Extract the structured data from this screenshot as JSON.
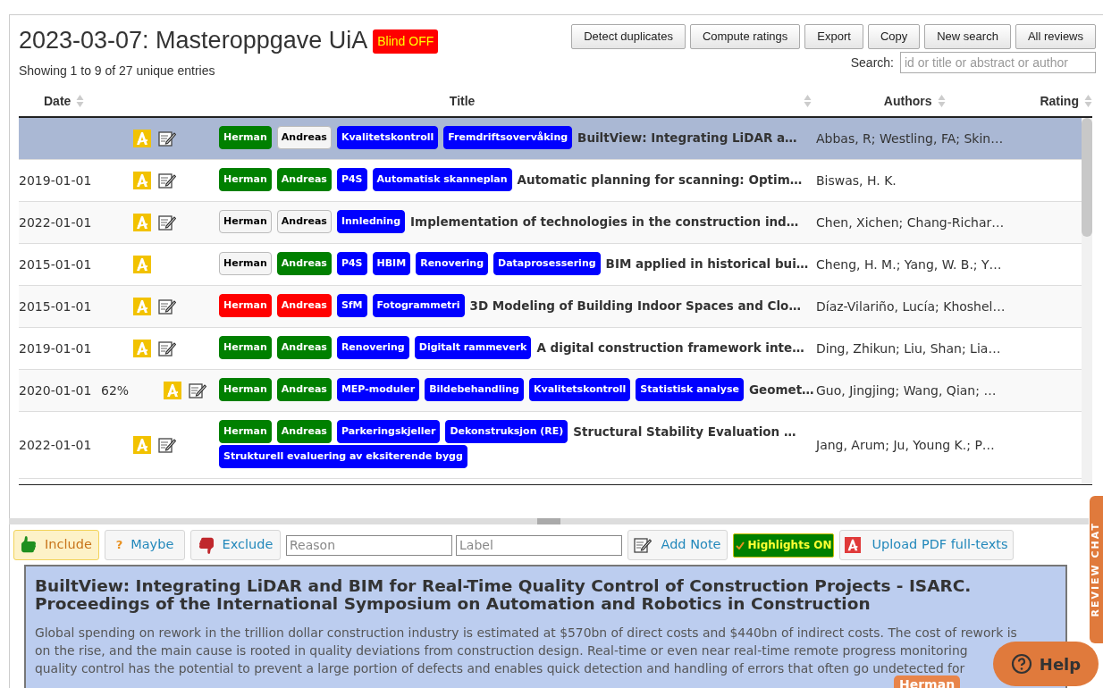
{
  "header": {
    "title": "2023-03-07: Masteroppgave UiA",
    "blind": {
      "label": "Blind OFF",
      "on": false
    },
    "summary": "Showing 1 to 9 of 27 unique entries"
  },
  "toolbar": [
    "Detect duplicates",
    "Compute ratings",
    "Export",
    "Copy",
    "New search",
    "All reviews"
  ],
  "search": {
    "label": "Search:",
    "placeholder": "id or title or abstract or author"
  },
  "table": {
    "columns": [
      "Date",
      "Title",
      "Authors",
      "Rating"
    ],
    "rows": [
      {
        "selected": true,
        "date": "",
        "score": "",
        "has_note": true,
        "tags": [
          {
            "label": "Herman",
            "color": "#008000"
          },
          {
            "label": "Andreas",
            "color": "#f5f5f5"
          },
          {
            "label": "Kvalitetskontroll",
            "color": "#0000ff"
          },
          {
            "label": "Fremdriftsovervåking",
            "color": "#0000ff"
          }
        ],
        "title": "BuiltView: Integrating LiDAR a…",
        "authors": "Abbas, R; Westling, FA; Skin…"
      },
      {
        "selected": false,
        "date": "2019-01-01",
        "score": "",
        "has_note": true,
        "tags": [
          {
            "label": "Herman",
            "color": "#008000"
          },
          {
            "label": "Andreas",
            "color": "#008000"
          },
          {
            "label": "P4S",
            "color": "#0000ff"
          },
          {
            "label": "Automatisk skanneplan",
            "color": "#0000ff"
          }
        ],
        "title": "Automatic planning for scanning: Optim…",
        "authors": "Biswas, H. K."
      },
      {
        "selected": false,
        "date": "2022-01-01",
        "score": "",
        "has_note": true,
        "tags": [
          {
            "label": "Herman",
            "color": "#f5f5f5"
          },
          {
            "label": "Andreas",
            "color": "#f5f5f5"
          },
          {
            "label": "Innledning",
            "color": "#0000ff"
          }
        ],
        "title": "Implementation of technologies in the construction ind…",
        "authors": "Chen, Xichen; Chang-Richar…"
      },
      {
        "selected": false,
        "date": "2015-01-01",
        "score": "",
        "has_note": false,
        "tags": [
          {
            "label": "Herman",
            "color": "#f5f5f5"
          },
          {
            "label": "Andreas",
            "color": "#008000"
          },
          {
            "label": "P4S",
            "color": "#0000ff"
          },
          {
            "label": "HBIM",
            "color": "#0000ff"
          },
          {
            "label": "Renovering",
            "color": "#0000ff"
          },
          {
            "label": "Dataprosessering",
            "color": "#0000ff"
          }
        ],
        "title": "BIM applied in historical bui…",
        "authors": "Cheng, H. M.; Yang, W. B.; Y…"
      },
      {
        "selected": false,
        "date": "2015-01-01",
        "score": "",
        "has_note": true,
        "tags": [
          {
            "label": "Herman",
            "color": "#ff0000"
          },
          {
            "label": "Andreas",
            "color": "#ff0000"
          },
          {
            "label": "SfM",
            "color": "#0000ff"
          },
          {
            "label": "Fotogrammetri",
            "color": "#0000ff"
          }
        ],
        "title": "3D Modeling of Building Indoor Spaces and Clo…",
        "authors": "Díaz-Vilariño, Lucía; Khoshel…"
      },
      {
        "selected": false,
        "date": "2019-01-01",
        "score": "",
        "has_note": true,
        "tags": [
          {
            "label": "Herman",
            "color": "#008000"
          },
          {
            "label": "Andreas",
            "color": "#008000"
          },
          {
            "label": "Renovering",
            "color": "#0000ff"
          },
          {
            "label": "Digitalt rammeverk",
            "color": "#0000ff"
          }
        ],
        "title": "A digital construction framework inte…",
        "authors": "Ding, Zhikun; Liu, Shan; Lia…"
      },
      {
        "selected": false,
        "date": "2020-01-01",
        "score": "62%",
        "has_note": true,
        "tags": [
          {
            "label": "Herman",
            "color": "#008000"
          },
          {
            "label": "Andreas",
            "color": "#008000"
          },
          {
            "label": "MEP-moduler",
            "color": "#0000ff"
          },
          {
            "label": "Bildebehandling",
            "color": "#0000ff"
          },
          {
            "label": "Kvalitetskontroll",
            "color": "#0000ff"
          },
          {
            "label": "Statistisk analyse",
            "color": "#0000ff"
          }
        ],
        "title": "Geomet…",
        "authors": "Guo, Jingjing; Wang, Qian; …"
      },
      {
        "selected": false,
        "date": "2022-01-01",
        "score": "",
        "has_note": true,
        "tags": [
          {
            "label": "Herman",
            "color": "#008000"
          },
          {
            "label": "Andreas",
            "color": "#008000"
          },
          {
            "label": "Parkeringskjeller",
            "color": "#0000ff"
          },
          {
            "label": "Dekonstruksjon (RE)",
            "color": "#0000ff"
          },
          {
            "label": "Strukturell evaluering av eksiterende bygg",
            "color": "#0000ff"
          }
        ],
        "title": "Structural Stability Evaluation …",
        "authors": "Jang, Arum; Ju, Young K.; P…"
      }
    ]
  },
  "decision": [
    {
      "kind": "include",
      "label": "Include",
      "selected": true
    },
    {
      "kind": "maybe",
      "icon": "?",
      "label": "Maybe",
      "selected": false
    },
    {
      "kind": "exclude",
      "label": "Exclude",
      "selected": false
    }
  ],
  "reason": {
    "placeholder": "Reason"
  },
  "label_field": {
    "placeholder": "Label"
  },
  "add_note": "Add Note",
  "highlights": {
    "label": "Highlights ON",
    "on": true
  },
  "upload": "Upload PDF full-texts",
  "detail": {
    "title": "BuiltView: Integrating LiDAR and BIM for Real-Time Quality Control of Construction Projects - ISARC. Proceedings of the International Symposium on Automation and Robotics in Construction",
    "abstract_lines": [
      "Global spending on rework in the trillion dollar construction industry is estimated at $570bn of direct costs and $440bn of indirect costs. The cost of rework is",
      "on the rise, and the main cause is rooted in quality deviations from construction design. Real-time or even near real-time remote progress monitoring",
      "quality control has the potential to prevent a large portion of defects and enables quick detection and handling of errors that often go undetected for"
    ]
  },
  "chat_tab": "REVIEW CHAT",
  "user_tab": "Herman",
  "help": "Help"
}
